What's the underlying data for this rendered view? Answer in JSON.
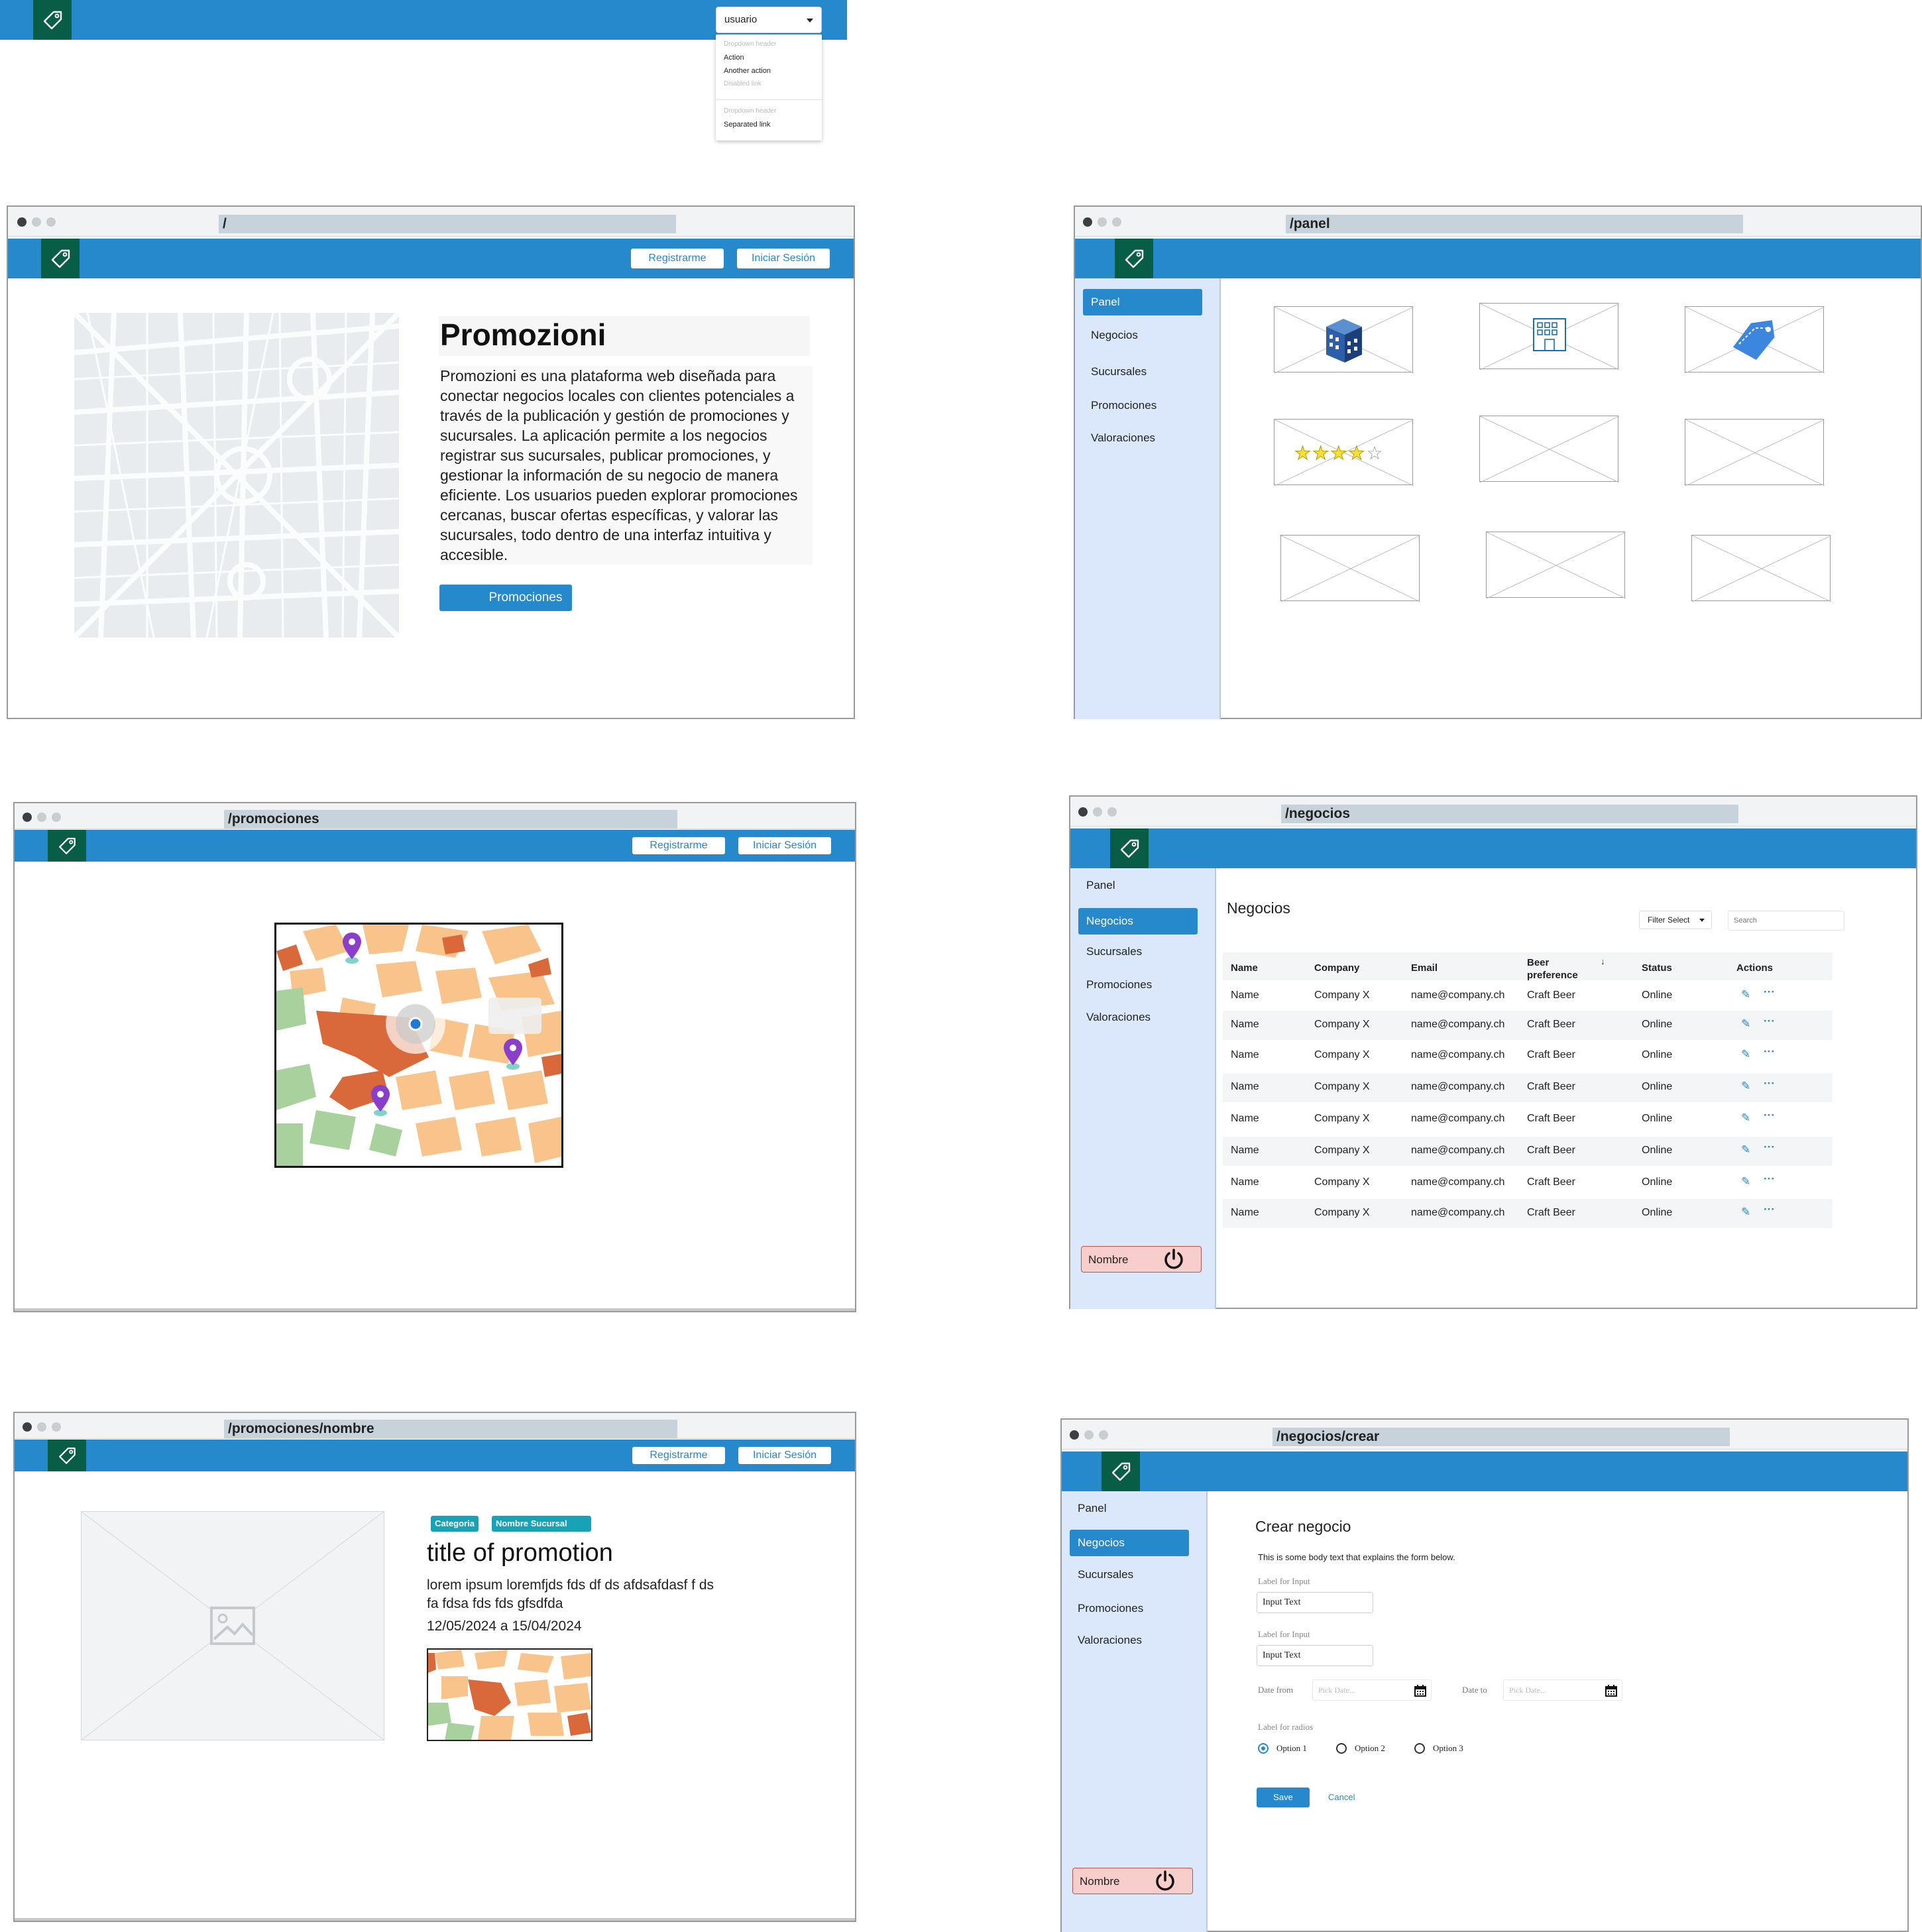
{
  "colors": {
    "primary": "#2589cc",
    "logo_bg": "#075d45",
    "sidebar_bg": "#dbe8fb",
    "logout_bg": "#f8cecc"
  },
  "dropdown_demo": {
    "select_value": "usuario",
    "items": [
      "Dropdown header",
      "Action",
      "Another action",
      "Disabled link",
      "Dropdown header",
      "Separated link"
    ]
  },
  "nav": {
    "register": "Registrarme",
    "login": "Iniciar Sesión"
  },
  "home": {
    "url": "/",
    "title": "Promozioni",
    "description": "Promozioni es una plataforma web diseñada para conectar negocios locales con clientes potenciales a través de la publicación y gestión de promociones y sucursales. La aplicación permite a los negocios registrar sus sucursales, publicar promociones, y gestionar la información de su negocio de manera eficiente. Los usuarios pueden explorar promociones cercanas, buscar ofertas específicas, y valorar las sucursales, todo dentro de una interfaz intuitiva y accesible.",
    "cta": "Promociones"
  },
  "panel": {
    "url": "/panel",
    "menu": [
      "Panel",
      "Negocios",
      "Sucursales",
      "Promociones",
      "Valoraciones"
    ],
    "tiles": [
      "building-icon",
      "office-icon",
      "tag-icon",
      "star-rating",
      "",
      "",
      "",
      "",
      ""
    ],
    "rating": 4
  },
  "promociones": {
    "url": "/promociones"
  },
  "negocios": {
    "url": "/negocios",
    "title": "Negocios",
    "filter": "Filter Select",
    "search_placeholder": "Search",
    "columns": [
      "Name",
      "Company",
      "Email",
      "Beer preference",
      "Status",
      "Actions"
    ],
    "rows": [
      [
        "Name",
        "Company X",
        "name@company.ch",
        "Craft Beer",
        "Online"
      ],
      [
        "Name",
        "Company X",
        "name@company.ch",
        "Craft Beer",
        "Online"
      ],
      [
        "Name",
        "Company X",
        "name@company.ch",
        "Craft Beer",
        "Online"
      ],
      [
        "Name",
        "Company X",
        "name@company.ch",
        "Craft Beer",
        "Online"
      ],
      [
        "Name",
        "Company X",
        "name@company.ch",
        "Craft Beer",
        "Online"
      ],
      [
        "Name",
        "Company X",
        "name@company.ch",
        "Craft Beer",
        "Online"
      ],
      [
        "Name",
        "Company X",
        "name@company.ch",
        "Craft Beer",
        "Online"
      ],
      [
        "Name",
        "Company X",
        "name@company.ch",
        "Craft Beer",
        "Online"
      ]
    ],
    "user": "Nombre"
  },
  "promocion_detalle": {
    "url": "/promociones/nombre",
    "badge_category": "Categoria",
    "badge_branch": "Nombre Sucursal",
    "title": "title of promotion",
    "body": "lorem ipsum loremfjds fds df ds afdsafdasf f ds fa fdsa fds fds gfsdfda",
    "dates": "12/05/2024 a 15/04/2024"
  },
  "crear_negocio": {
    "url": "/negocios/crear",
    "title": "Crear negocio",
    "body": "This is some body text that explains the form below.",
    "label1": "Label for Input",
    "input1": "Input Text",
    "label2": "Label for Input",
    "input2": "Input Text",
    "date_from_label": "Date from",
    "date_to_label": "Date to",
    "date_placeholder": "Pick Date...",
    "radios_label": "Label for radios",
    "radios": [
      "Option 1",
      "Option 2",
      "Option 3"
    ],
    "save": "Save",
    "cancel": "Cancel",
    "user": "Nombre"
  }
}
